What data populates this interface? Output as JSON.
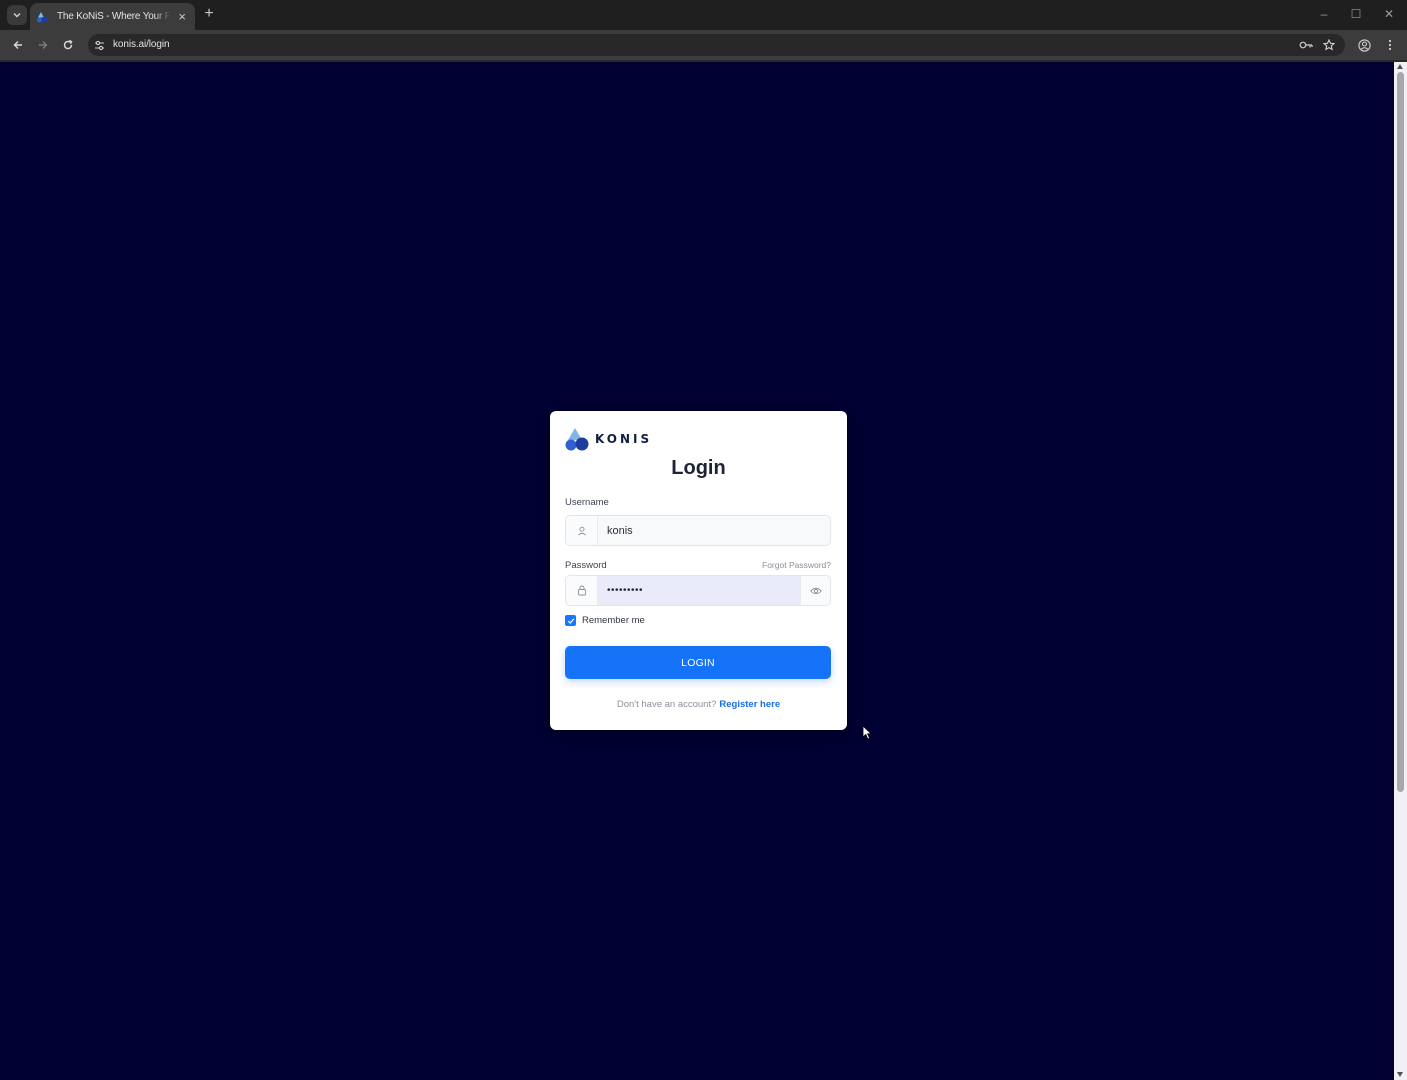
{
  "browser": {
    "tab": {
      "title": "The KoNiS - Where Your Future",
      "favicon": "konis-logo-icon"
    },
    "url": "konis.ai/login",
    "icons": {
      "tab_menu": "chevron-down-icon",
      "new_tab": "+",
      "close_tab": "×",
      "back": "arrow-left-icon",
      "forward": "arrow-right-icon",
      "reload": "reload-icon",
      "site_info": "tune-icon",
      "password_key": "key-icon",
      "bookmark": "star-icon",
      "profile": "profile-icon",
      "menu": "kebab-menu-icon"
    },
    "window_controls": {
      "minimize": "–",
      "maximize": "☐",
      "close": "✕"
    }
  },
  "login": {
    "brand": "KONIS",
    "title": "Login",
    "username": {
      "label": "Username",
      "value": "konis",
      "icon": "user-icon"
    },
    "password": {
      "label": "Password",
      "value": "•••••••••",
      "icon": "lock-icon",
      "toggle_icon": "eye-icon",
      "forgot_label": "Forgot Password?"
    },
    "remember": {
      "label": "Remember me",
      "checked": true
    },
    "submit_label": "LOGIN",
    "register_prompt": "Don't have an account?",
    "register_link": "Register here"
  },
  "colors": {
    "page_background": "#000033",
    "primary": "#1473f7",
    "link": "#1a6ee8",
    "brand_dark": "#10203f",
    "brand_light": "#7fb6e8"
  }
}
